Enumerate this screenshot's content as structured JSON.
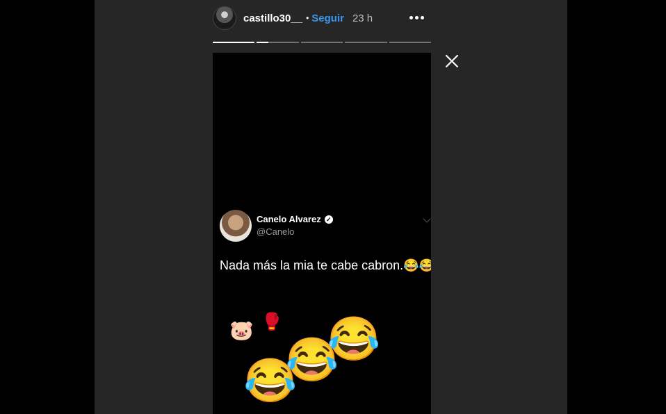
{
  "header": {
    "username": "castillo30__",
    "separator": "•",
    "follow_label": "Seguir",
    "time_ago": "23 h"
  },
  "progress": {
    "segments": [
      1,
      0.28,
      0,
      0,
      0
    ]
  },
  "tweet": {
    "name": "Canelo Alvarez",
    "verified_glyph": "✓",
    "handle": "@Canelo",
    "text": "Nada más la mia te cabe cabron.😂😂"
  },
  "stickers": {
    "pig": "🐷",
    "boxing_glove": "🥊",
    "laugh": "😂"
  }
}
